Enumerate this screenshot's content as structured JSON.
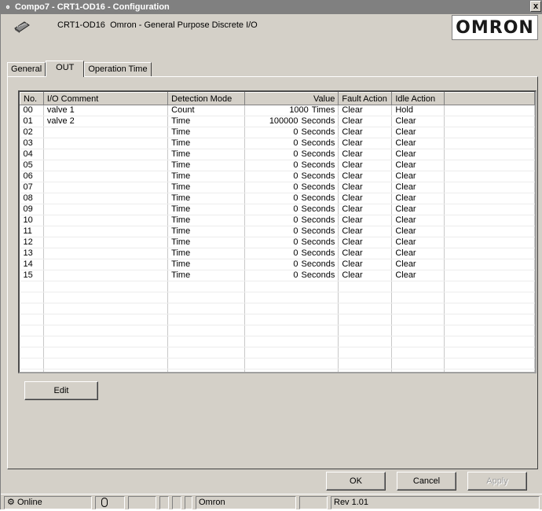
{
  "window": {
    "title": "Compo7 - CRT1-OD16 - Configuration",
    "close_glyph": "x"
  },
  "header": {
    "device_model": "CRT1-OD16",
    "device_desc": "Omron - General Purpose Discrete I/O",
    "logo_text": "OMRON",
    "icon": "device-module-icon"
  },
  "tabs": [
    {
      "label": "General",
      "active": false
    },
    {
      "label": "OUT",
      "active": true
    },
    {
      "label": "Operation Time",
      "active": false
    }
  ],
  "grid": {
    "columns": [
      "No.",
      "I/O Comment",
      "Detection Mode",
      "Value",
      "Fault Action",
      "Idle Action",
      ""
    ],
    "rows": [
      {
        "no": "00",
        "comment": "valve 1",
        "mode": "Count",
        "value": "1000",
        "unit": "Times",
        "fault": "Clear",
        "idle": "Hold"
      },
      {
        "no": "01",
        "comment": "valve 2",
        "mode": "Time",
        "value": "100000",
        "unit": "Seconds",
        "fault": "Clear",
        "idle": "Clear"
      },
      {
        "no": "02",
        "comment": "",
        "mode": "Time",
        "value": "0",
        "unit": "Seconds",
        "fault": "Clear",
        "idle": "Clear"
      },
      {
        "no": "03",
        "comment": "",
        "mode": "Time",
        "value": "0",
        "unit": "Seconds",
        "fault": "Clear",
        "idle": "Clear"
      },
      {
        "no": "04",
        "comment": "",
        "mode": "Time",
        "value": "0",
        "unit": "Seconds",
        "fault": "Clear",
        "idle": "Clear"
      },
      {
        "no": "05",
        "comment": "",
        "mode": "Time",
        "value": "0",
        "unit": "Seconds",
        "fault": "Clear",
        "idle": "Clear"
      },
      {
        "no": "06",
        "comment": "",
        "mode": "Time",
        "value": "0",
        "unit": "Seconds",
        "fault": "Clear",
        "idle": "Clear"
      },
      {
        "no": "07",
        "comment": "",
        "mode": "Time",
        "value": "0",
        "unit": "Seconds",
        "fault": "Clear",
        "idle": "Clear"
      },
      {
        "no": "08",
        "comment": "",
        "mode": "Time",
        "value": "0",
        "unit": "Seconds",
        "fault": "Clear",
        "idle": "Clear"
      },
      {
        "no": "09",
        "comment": "",
        "mode": "Time",
        "value": "0",
        "unit": "Seconds",
        "fault": "Clear",
        "idle": "Clear"
      },
      {
        "no": "10",
        "comment": "",
        "mode": "Time",
        "value": "0",
        "unit": "Seconds",
        "fault": "Clear",
        "idle": "Clear"
      },
      {
        "no": "11",
        "comment": "",
        "mode": "Time",
        "value": "0",
        "unit": "Seconds",
        "fault": "Clear",
        "idle": "Clear"
      },
      {
        "no": "12",
        "comment": "",
        "mode": "Time",
        "value": "0",
        "unit": "Seconds",
        "fault": "Clear",
        "idle": "Clear"
      },
      {
        "no": "13",
        "comment": "",
        "mode": "Time",
        "value": "0",
        "unit": "Seconds",
        "fault": "Clear",
        "idle": "Clear"
      },
      {
        "no": "14",
        "comment": "",
        "mode": "Time",
        "value": "0",
        "unit": "Seconds",
        "fault": "Clear",
        "idle": "Clear"
      },
      {
        "no": "15",
        "comment": "",
        "mode": "Time",
        "value": "0",
        "unit": "Seconds",
        "fault": "Clear",
        "idle": "Clear"
      }
    ],
    "empty_rows": 9
  },
  "buttons": {
    "edit": "Edit",
    "ok": "OK",
    "cancel": "Cancel",
    "apply": "Apply"
  },
  "status": {
    "connection": "Online",
    "connection_icon": "network-icon",
    "vendor": "Omron",
    "revision": "Rev 1.01"
  }
}
